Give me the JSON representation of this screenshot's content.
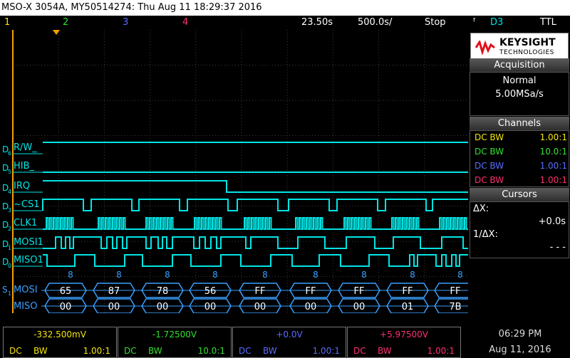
{
  "title": "MSO-X 3054A, MY50514274: Thu Aug 11 18:29:37 2016",
  "header": {
    "channels": [
      "1",
      "2",
      "3",
      "4"
    ],
    "channel_colors": [
      "#f5e60a",
      "#30e030",
      "#5a6cff",
      "#ff3070"
    ],
    "timebase_delay": "23.50s",
    "timebase_scale": "500.0s/",
    "run_state": "Stop",
    "trigger_symbol": "ᶠ",
    "trigger_source": "D3",
    "trigger_type": "TTL"
  },
  "brand": {
    "name": "KEYSIGHT",
    "sub": "TECHNOLOGIES"
  },
  "acquisition": {
    "title": "Acquisition",
    "mode": "Normal",
    "rate": "5.00MSa/s"
  },
  "channels_panel": {
    "title": "Channels",
    "rows": [
      {
        "coupling": "DC BW",
        "scale": "1.00:1",
        "color": "#f5e60a"
      },
      {
        "coupling": "DC BW",
        "scale": "10.0:1",
        "color": "#30e030"
      },
      {
        "coupling": "DC BW",
        "scale": "1.00:1",
        "color": "#5a6cff"
      },
      {
        "coupling": "DC BW",
        "scale": "1.00:1",
        "color": "#ff3070"
      }
    ]
  },
  "cursors": {
    "title": "Cursors",
    "dx_label": "ΔX:",
    "dx_value": "+0.0s",
    "inv_label": "1/ΔX:",
    "inv_value": "- - -"
  },
  "digital": [
    {
      "id": "D6",
      "label": "R/W_"
    },
    {
      "id": "D5",
      "label": "HIB_"
    },
    {
      "id": "D4",
      "label": "IRQ"
    },
    {
      "id": "D3",
      "label": "~CS1"
    },
    {
      "id": "D2",
      "label": "CLK1"
    },
    {
      "id": "D1",
      "label": "MOSI1"
    },
    {
      "id": "D0",
      "label": "MISO1"
    }
  ],
  "bus": {
    "id": "S1",
    "rows": [
      "MOSI",
      "MISO"
    ],
    "counts": [
      "8",
      "8",
      "8",
      "8",
      "8",
      "8",
      "8",
      "8",
      "8"
    ],
    "mosi": [
      "65",
      "87",
      "78",
      "56",
      "FF",
      "FF",
      "FF",
      "FF",
      "FF"
    ],
    "miso": [
      "00",
      "00",
      "00",
      "00",
      "00",
      "00",
      "00",
      "01",
      "7B"
    ]
  },
  "bottom": [
    {
      "value": "-332.500mV",
      "dc": "DC",
      "bw": "BW",
      "scale": "1.00:1",
      "color": "#f5e60a"
    },
    {
      "value": "-1.72500V",
      "dc": "DC",
      "bw": "BW",
      "scale": "10.0:1",
      "color": "#30e030"
    },
    {
      "value": "+0.0V",
      "dc": "DC",
      "bw": "BW",
      "scale": "1.00:1",
      "color": "#5a6cff"
    },
    {
      "value": "+5.97500V",
      "dc": "DC",
      "bw": "BW",
      "scale": "1.00:1",
      "color": "#ff3070"
    }
  ],
  "clock": {
    "time": "06:29 PM",
    "date": "Aug 11, 2016"
  },
  "colors": {
    "digital": "#00e5e5",
    "digital_high": "#38e838",
    "bus": "#3aa0ff",
    "grid": "#3c3c3c",
    "trigger_line": "#f5a000"
  }
}
